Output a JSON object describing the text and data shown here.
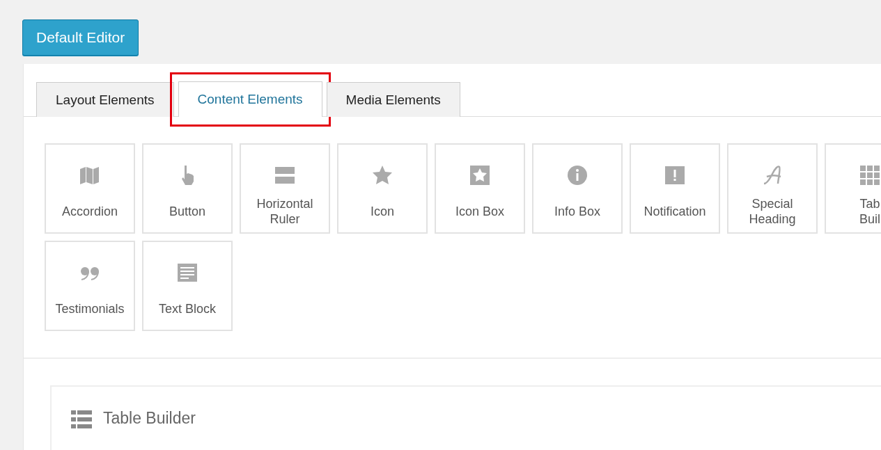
{
  "editor_button": "Default Editor",
  "tabs": [
    {
      "label": "Layout Elements",
      "selected": false,
      "highlighted": false
    },
    {
      "label": "Content Elements",
      "selected": true,
      "highlighted": true
    },
    {
      "label": "Media Elements",
      "selected": false,
      "highlighted": false
    }
  ],
  "elements": [
    {
      "lines": [
        "Accordion"
      ]
    },
    {
      "lines": [
        "Button"
      ]
    },
    {
      "lines": [
        "Horizontal",
        "Ruler"
      ]
    },
    {
      "lines": [
        "Icon"
      ]
    },
    {
      "lines": [
        "Icon Box"
      ]
    },
    {
      "lines": [
        "Info Box"
      ]
    },
    {
      "lines": [
        "Notification"
      ]
    },
    {
      "lines": [
        "Special",
        "Heading"
      ]
    },
    {
      "lines": [
        "Tab",
        "Buil"
      ]
    },
    {
      "lines": [
        "Testimonials"
      ]
    },
    {
      "lines": [
        "Text Block"
      ]
    }
  ],
  "builder": {
    "title": "Table Builder"
  }
}
